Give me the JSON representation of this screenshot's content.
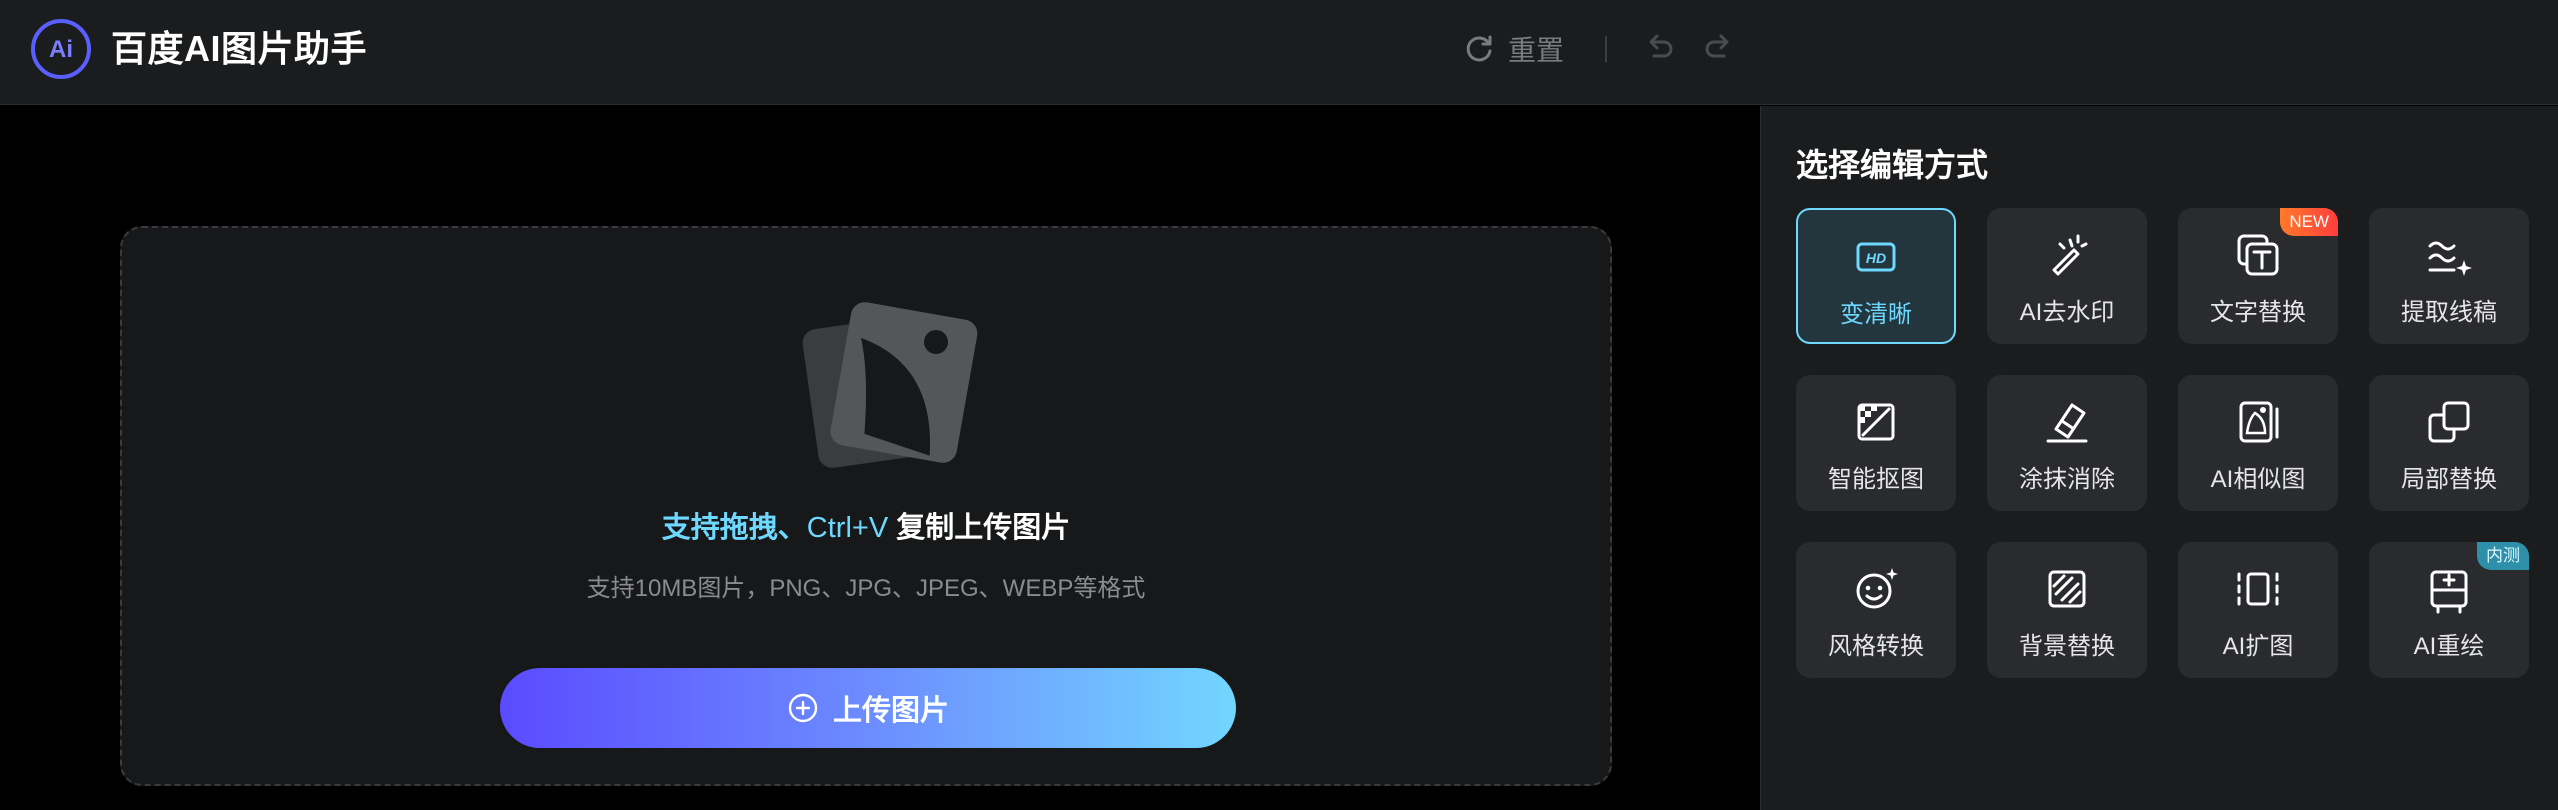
{
  "header": {
    "app_title": "百度AI图片助手",
    "logo_text": "Ai",
    "reset_label": "重置",
    "icons": {
      "logo": "ai-logo-icon",
      "reset": "refresh-icon",
      "undo": "undo-icon",
      "redo": "redo-icon"
    }
  },
  "canvas": {
    "hint_part1": "支持拖拽、",
    "hint_part2": "Ctrl+V",
    "hint_part3": " 复制上传图片",
    "format_note": "支持10MB图片，PNG、JPG、JPEG、WEBP等格式",
    "upload_label": "上传图片",
    "icons": {
      "placeholder": "photo-stack-icon",
      "upload": "plus-circle-icon"
    }
  },
  "panel": {
    "title": "选择编辑方式",
    "tools": [
      {
        "label": "变清晰",
        "icon": "hd-icon",
        "active": true
      },
      {
        "label": "AI去水印",
        "icon": "magic-wand-icon"
      },
      {
        "label": "文字替换",
        "icon": "text-replace-icon",
        "badge": "NEW"
      },
      {
        "label": "提取线稿",
        "icon": "sketch-lines-icon"
      },
      {
        "label": "智能抠图",
        "icon": "cutout-icon"
      },
      {
        "label": "涂抹消除",
        "icon": "eraser-icon"
      },
      {
        "label": "AI相似图",
        "icon": "similar-image-icon"
      },
      {
        "label": "局部替换",
        "icon": "partial-replace-icon"
      },
      {
        "label": "风格转换",
        "icon": "style-transfer-icon"
      },
      {
        "label": "背景替换",
        "icon": "background-replace-icon"
      },
      {
        "label": "AI扩图",
        "icon": "expand-image-icon"
      },
      {
        "label": "AI重绘",
        "icon": "redraw-icon",
        "badge": "内测"
      }
    ]
  },
  "colors": {
    "accent": "#6ed8ff",
    "brand": "#5a5fff",
    "panel_bg": "#1b1c1e",
    "tile_bg": "#2a2b2e"
  }
}
